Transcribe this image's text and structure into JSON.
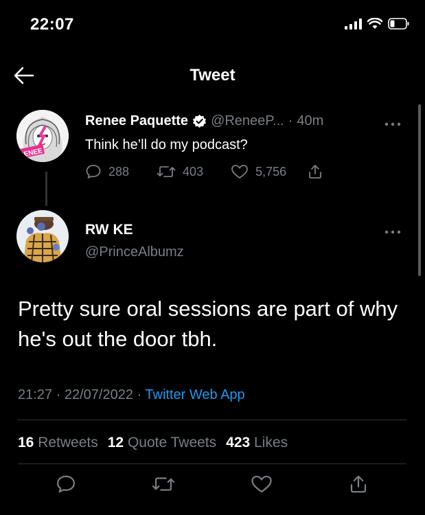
{
  "status_bar": {
    "time": "22:07"
  },
  "header": {
    "title": "Tweet"
  },
  "parent_tweet": {
    "name": "Renee Paquette",
    "handle": "@ReneeP...",
    "separator": "·",
    "age": "40m",
    "text": "Think he’ll do my podcast?",
    "avatar_text": "RENEE",
    "replies": "288",
    "retweets": "403",
    "likes": "5,756"
  },
  "main_tweet": {
    "name": "RW KE",
    "handle": "@PrinceAlbumz",
    "text": "Pretty sure oral sessions are part of why he's out the door tbh.",
    "time": "21:27",
    "date": "22/07/2022",
    "separator": "·",
    "source": "Twitter Web App",
    "retweets_count": "16",
    "retweets_label": "Retweets",
    "quotes_count": "12",
    "quotes_label": "Quote Tweets",
    "likes_count": "423",
    "likes_label": "Likes"
  },
  "colors": {
    "background": "#000000",
    "secondary_text": "#7a7f84",
    "link": "#1d9bf0",
    "divider": "#2f3336"
  },
  "icons": [
    "back-arrow-icon",
    "verified-icon",
    "more-icon",
    "reply-icon",
    "retweet-icon",
    "like-icon",
    "share-icon",
    "signal-icon",
    "wifi-icon",
    "battery-icon"
  ]
}
